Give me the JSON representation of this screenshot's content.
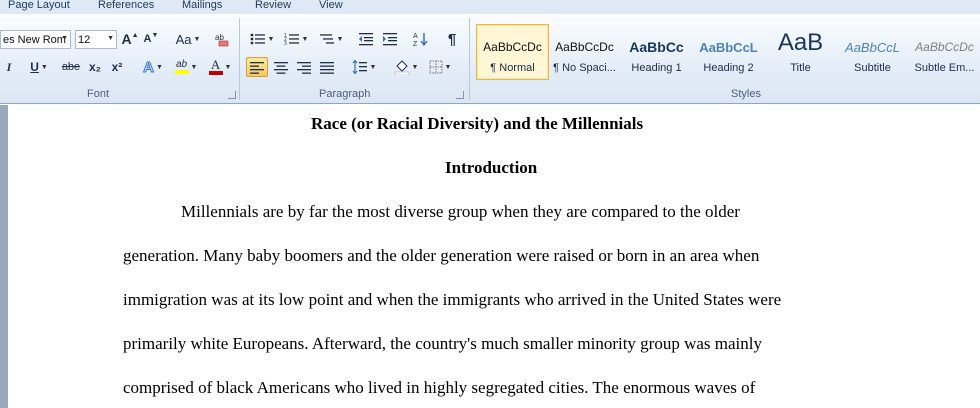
{
  "tabs": [
    "Page Layout",
    "References",
    "Mailings",
    "Review",
    "View"
  ],
  "font_group": {
    "label": "Font",
    "font_name": "es New Rom",
    "font_size": "12",
    "grow_icon": "A",
    "shrink_icon": "A",
    "change_case": "Aa",
    "italic": "I",
    "underline": "U",
    "strikethrough": "abe",
    "subscript": "x₂",
    "superscript": "x²",
    "text_effects": "A",
    "highlight": "ab",
    "font_color": "A"
  },
  "paragraph_group": {
    "label": "Paragraph",
    "pilcrow": "¶"
  },
  "styles_group": {
    "label": "Styles",
    "items": [
      {
        "sample": "AaBbCcDc",
        "name": "¶ Normal"
      },
      {
        "sample": "AaBbCcDc",
        "name": "¶ No Spaci..."
      },
      {
        "sample": "AaBbCc",
        "name": "Heading 1"
      },
      {
        "sample": "AaBbCcL",
        "name": "Heading 2"
      },
      {
        "sample": "AaB",
        "name": "Title"
      },
      {
        "sample": "AaBbCcL",
        "name": "Subtitle"
      },
      {
        "sample": "AaBbCcDc",
        "name": "Subtle Em..."
      }
    ]
  },
  "document": {
    "title": "Race (or Racial Diversity) and the Millennials",
    "heading": "Introduction",
    "lines": [
      "Millennials are by far the most diverse group when they are compared to the older",
      "generation. Many baby boomers and the older generation were  raised or born in an area when",
      "immigration was at its low point and when the immigrants who arrived in the United States were",
      "primarily white Europeans. Afterward, the country's much smaller minority group was mainly",
      "comprised of black Americans who lived in highly segregated cities.  The enormous waves of"
    ]
  },
  "colors": {
    "accent_selected": "#f7c85a",
    "heading1": "#17365d",
    "heading2": "#4f81bd",
    "highlight": "#ffff00",
    "font_color": "#c00000"
  }
}
